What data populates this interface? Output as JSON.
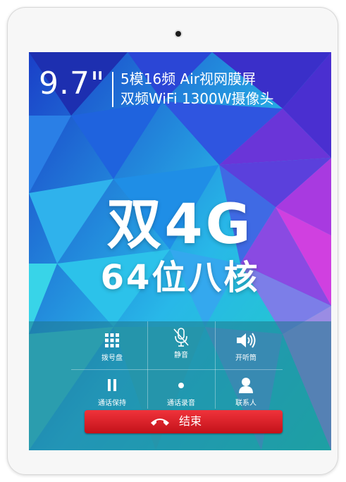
{
  "specs": {
    "size": "9.7\"",
    "line1": "5模16频   Air视网膜屏",
    "line2": "双频WiFi  1300W摄像头"
  },
  "headline": {
    "main": "双4G",
    "sub": "64位八核"
  },
  "call_controls": [
    {
      "label": "拨号盘",
      "icon": "dialpad-icon"
    },
    {
      "label": "静音",
      "icon": "mute-mic-icon"
    },
    {
      "label": "开听筒",
      "icon": "speaker-icon"
    },
    {
      "label": "通话保持",
      "icon": "pause-icon"
    },
    {
      "label": "通话录音",
      "icon": "record-dot-icon"
    },
    {
      "label": "联系人",
      "icon": "contact-person-icon"
    }
  ],
  "end_call": {
    "label": "结束",
    "icon": "hang-up-phone-icon"
  },
  "colors": {
    "end_button": "#e0242c",
    "panel_tint": "#1e788c"
  }
}
